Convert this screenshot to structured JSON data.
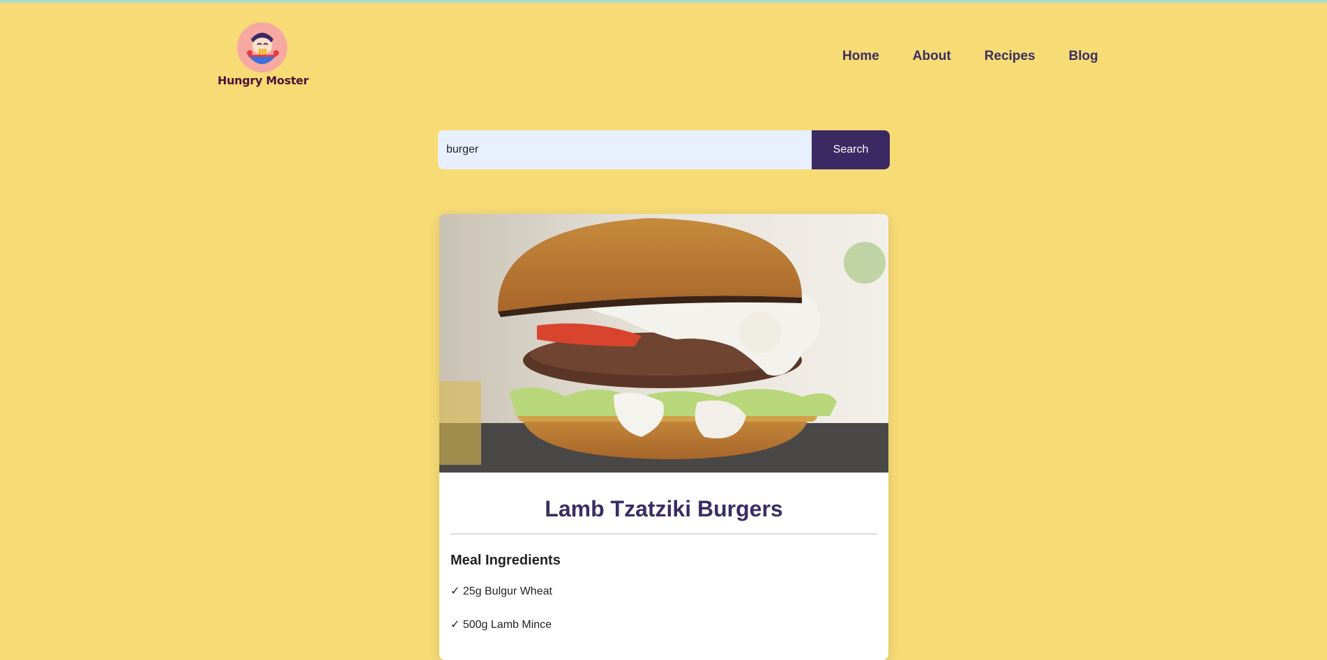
{
  "brand": {
    "name": "Hungry Moster"
  },
  "nav": {
    "items": [
      "Home",
      "About",
      "Recipes",
      "Blog"
    ]
  },
  "search": {
    "value": "burger",
    "button_label": "Search"
  },
  "meal": {
    "title": "Lamb Tzatziki Burgers",
    "ingredients_heading": "Meal Ingredients",
    "ingredients": [
      "✓ 25g Bulgur Wheat",
      "✓ 500g Lamb Mince"
    ]
  },
  "colors": {
    "background": "#f7db75",
    "accent": "#3b2963",
    "nav_text": "#3a2d63",
    "input_bg": "#e8f0fe"
  },
  "icons": {
    "logo": "chef-eating-noodles-icon"
  }
}
